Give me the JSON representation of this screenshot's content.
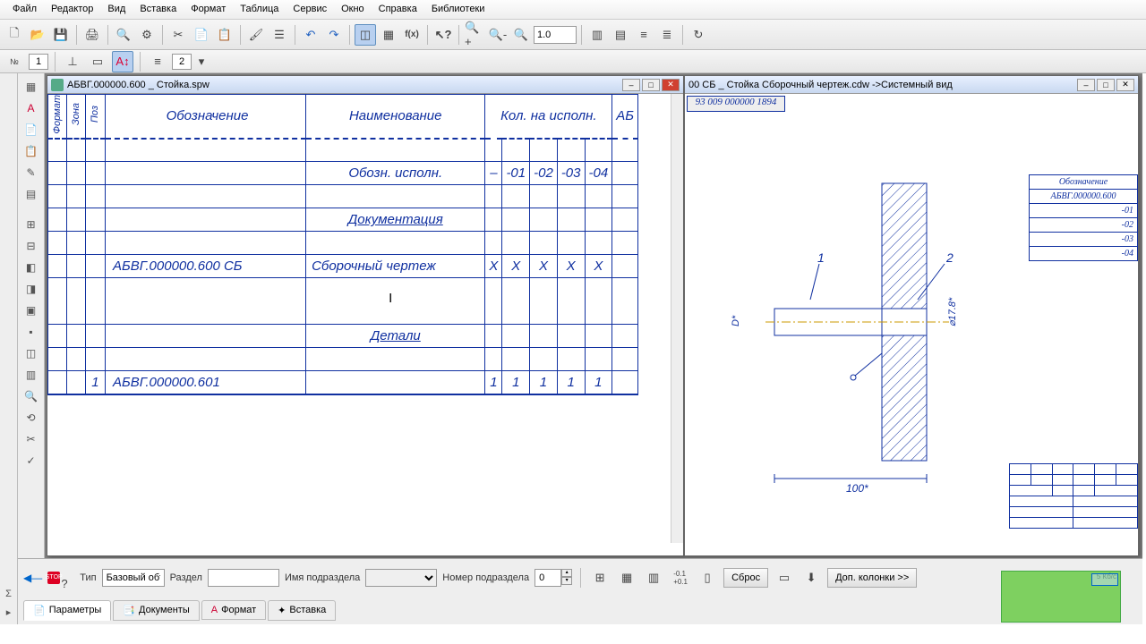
{
  "menu": [
    "Файл",
    "Редактор",
    "Вид",
    "Вставка",
    "Формат",
    "Таблица",
    "Сервис",
    "Окно",
    "Справка",
    "Библиотеки"
  ],
  "toolbar2": {
    "val1": "1",
    "val2": "2"
  },
  "zoom": "1.0",
  "doc_left": {
    "title": "АБВГ.000000.600 _ Стойка.spw",
    "headers": {
      "fmt": "Формат",
      "zone": "Зона",
      "pos": "Поз",
      "des": "Обозначение",
      "name": "Наименование",
      "qty": "Кол. на исполн.",
      "abl": "АБ"
    },
    "exec_label": "Обозн. исполн.",
    "exec_cols": [
      "–",
      "-01",
      "-02",
      "-03",
      "-04"
    ],
    "section_doc": "Документация",
    "row_doc": {
      "des": "АБВГ.000000.600 СБ",
      "name": "Сборочный чертеж",
      "q": [
        "X",
        "X",
        "X",
        "X",
        "X"
      ]
    },
    "section_parts": "Детали",
    "row_part": {
      "pos": "1",
      "des": "АБВГ.000000.601",
      "q": [
        "1",
        "1",
        "1",
        "1",
        "1"
      ]
    }
  },
  "doc_right": {
    "title": "00 СБ _ Стойка Сборочный чертеж.cdw ->Системный вид",
    "ruler": "93 009 000000 1894",
    "dim1": "100*",
    "tbl_head": "Обозначение",
    "tbl_rows": [
      "АБВГ.000000.600",
      "-01",
      "-02",
      "-03",
      "-04"
    ]
  },
  "propbar": {
    "type_label": "Тип",
    "type_val": "Базовый объ",
    "section_label": "Раздел",
    "subname_label": "Имя подраздела",
    "subnum_label": "Номер подраздела",
    "subnum_val": "0",
    "reset": "Сброс",
    "extra": "Доп. колонки  >>"
  },
  "tabs": [
    "Параметры",
    "Документы",
    "Формат",
    "Вставка"
  ],
  "mini_label": "5 Кб/с"
}
